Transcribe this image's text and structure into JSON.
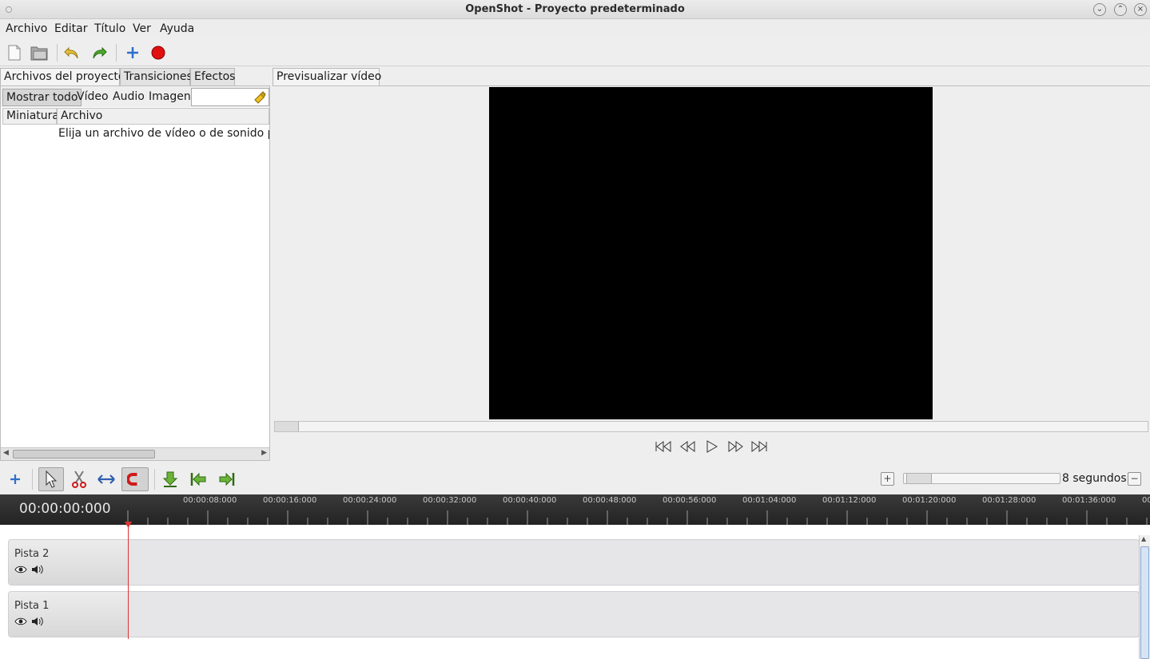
{
  "window": {
    "title": "OpenShot - Proyecto predeterminado"
  },
  "menu": {
    "items": [
      "Archivo",
      "Editar",
      "Título",
      "Ver",
      "Ayuda"
    ]
  },
  "toolbar": {
    "icons": [
      "new-project-icon",
      "save-project-icon",
      "undo-icon",
      "redo-icon",
      "import-files-icon",
      "export-video-icon"
    ]
  },
  "project_tabs": {
    "tabs": [
      "Archivos del proyecto",
      "Transiciones",
      "Efectos"
    ],
    "active_tab": "Archivos del proyecto"
  },
  "filters": {
    "buttons": [
      "Mostrar todo",
      "Vídeo",
      "Audio",
      "Imagen"
    ],
    "active": "Mostrar todo",
    "search_value": ""
  },
  "files_table": {
    "columns": [
      "Miniatura",
      "Archivo"
    ],
    "empty_message": "Elija un archivo de vídeo o de sonido par"
  },
  "preview": {
    "tab_label": "Previsualizar vídeo",
    "controls": [
      "jump-start-icon",
      "rewind-icon",
      "play-icon",
      "fast-forward-icon",
      "jump-end-icon"
    ]
  },
  "timeline_toolbar": {
    "zoom_label": "8 segundos",
    "tools": [
      "add-track-icon",
      "select-arrow-icon",
      "razor-icon",
      "resize-icon",
      "snap-magnet-icon",
      "add-marker-icon",
      "previous-marker-icon",
      "next-marker-icon"
    ]
  },
  "ruler": {
    "current_time": "00:00:00:000",
    "labels": [
      "00:00:08:000",
      "00:00:16:000",
      "00:00:24:000",
      "00:00:32:000",
      "00:00:40:000",
      "00:00:48:000",
      "00:00:56:000",
      "00:01:04:000",
      "00:01:12:000",
      "00:01:20:000",
      "00:01:28:000",
      "00:01:36:000",
      "00"
    ]
  },
  "tracks": [
    {
      "name": "Pista 2"
    },
    {
      "name": "Pista 1"
    }
  ],
  "colors": {
    "playhead": "#dd3333",
    "record": "#e01010",
    "ruler_bg": "#2e2e2e"
  }
}
